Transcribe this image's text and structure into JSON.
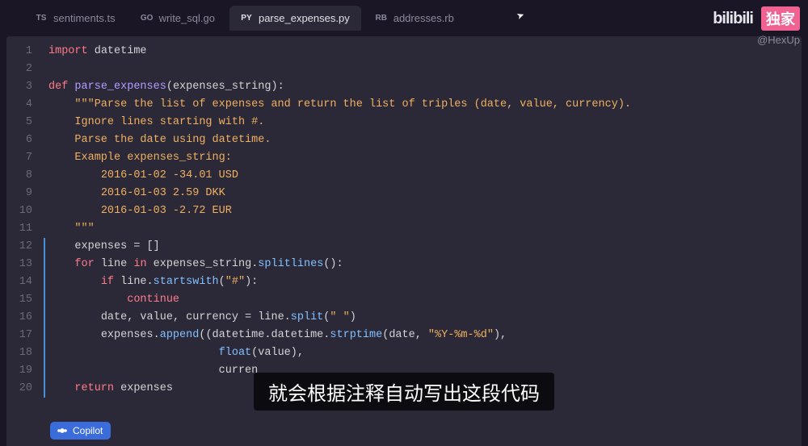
{
  "brand": {
    "logo_text": "bilibili",
    "exclusive_tag": "独家",
    "handle": "@HexUp"
  },
  "tabs": [
    {
      "icon": "TS",
      "label": "sentiments.ts",
      "active": false
    },
    {
      "icon": "GO",
      "label": "write_sql.go",
      "active": false
    },
    {
      "icon": "PY",
      "label": "parse_expenses.py",
      "active": true
    },
    {
      "icon": "RB",
      "label": "addresses.rb",
      "active": false
    }
  ],
  "code": {
    "lines": [
      {
        "n": 1,
        "hl": false,
        "tokens": [
          [
            "kw1",
            "import"
          ],
          [
            "pun",
            " "
          ],
          [
            "var",
            "datetime"
          ]
        ]
      },
      {
        "n": 2,
        "hl": false,
        "tokens": []
      },
      {
        "n": 3,
        "hl": false,
        "tokens": [
          [
            "kw2",
            "def"
          ],
          [
            "pun",
            " "
          ],
          [
            "fn",
            "parse_expenses"
          ],
          [
            "pun",
            "("
          ],
          [
            "var",
            "expenses_string"
          ],
          [
            "pun",
            "):"
          ]
        ]
      },
      {
        "n": 4,
        "hl": false,
        "tokens": [
          [
            "pun",
            "    "
          ],
          [
            "doc",
            "\"\"\"Parse the list of expenses and return the list of triples (date, value, currency)."
          ]
        ]
      },
      {
        "n": 5,
        "hl": false,
        "tokens": [
          [
            "pun",
            "    "
          ],
          [
            "doc",
            "Ignore lines starting with #."
          ]
        ]
      },
      {
        "n": 6,
        "hl": false,
        "tokens": [
          [
            "pun",
            "    "
          ],
          [
            "doc",
            "Parse the date using datetime."
          ]
        ]
      },
      {
        "n": 7,
        "hl": false,
        "tokens": [
          [
            "pun",
            "    "
          ],
          [
            "doc",
            "Example expenses_string:"
          ]
        ]
      },
      {
        "n": 8,
        "hl": false,
        "tokens": [
          [
            "pun",
            "        "
          ],
          [
            "doc",
            "2016-01-02 -34.01 USD"
          ]
        ]
      },
      {
        "n": 9,
        "hl": false,
        "tokens": [
          [
            "pun",
            "        "
          ],
          [
            "doc",
            "2016-01-03 2.59 DKK"
          ]
        ]
      },
      {
        "n": 10,
        "hl": false,
        "tokens": [
          [
            "pun",
            "        "
          ],
          [
            "doc",
            "2016-01-03 -2.72 EUR"
          ]
        ]
      },
      {
        "n": 11,
        "hl": false,
        "tokens": [
          [
            "pun",
            "    "
          ],
          [
            "doc",
            "\"\"\""
          ]
        ]
      },
      {
        "n": 12,
        "hl": true,
        "tokens": [
          [
            "pun",
            "    "
          ],
          [
            "var",
            "expenses"
          ],
          [
            "pun",
            " = []"
          ]
        ]
      },
      {
        "n": 13,
        "hl": true,
        "tokens": [
          [
            "pun",
            "    "
          ],
          [
            "kw3",
            "for"
          ],
          [
            "pun",
            " "
          ],
          [
            "var",
            "line"
          ],
          [
            "pun",
            " "
          ],
          [
            "kw3",
            "in"
          ],
          [
            "pun",
            " "
          ],
          [
            "var",
            "expenses_string"
          ],
          [
            "pun",
            "."
          ],
          [
            "mtd",
            "splitlines"
          ],
          [
            "pun",
            "():"
          ]
        ]
      },
      {
        "n": 14,
        "hl": true,
        "tokens": [
          [
            "pun",
            "        "
          ],
          [
            "kw3",
            "if"
          ],
          [
            "pun",
            " "
          ],
          [
            "var",
            "line"
          ],
          [
            "pun",
            "."
          ],
          [
            "mtd",
            "startswith"
          ],
          [
            "pun",
            "("
          ],
          [
            "str",
            "\"#\""
          ],
          [
            "pun",
            "):"
          ]
        ]
      },
      {
        "n": 15,
        "hl": true,
        "tokens": [
          [
            "pun",
            "            "
          ],
          [
            "kw3",
            "continue"
          ]
        ]
      },
      {
        "n": 16,
        "hl": true,
        "tokens": [
          [
            "pun",
            "        "
          ],
          [
            "var",
            "date"
          ],
          [
            "pun",
            ", "
          ],
          [
            "var",
            "value"
          ],
          [
            "pun",
            ", "
          ],
          [
            "var",
            "currency"
          ],
          [
            "pun",
            " = "
          ],
          [
            "var",
            "line"
          ],
          [
            "pun",
            "."
          ],
          [
            "mtd",
            "split"
          ],
          [
            "pun",
            "("
          ],
          [
            "str",
            "\" \""
          ],
          [
            "pun",
            ")"
          ]
        ]
      },
      {
        "n": 17,
        "hl": true,
        "tokens": [
          [
            "pun",
            "        "
          ],
          [
            "var",
            "expenses"
          ],
          [
            "pun",
            "."
          ],
          [
            "mtd",
            "append"
          ],
          [
            "pun",
            "(("
          ],
          [
            "var",
            "datetime"
          ],
          [
            "pun",
            "."
          ],
          [
            "var",
            "datetime"
          ],
          [
            "pun",
            "."
          ],
          [
            "mtd",
            "strptime"
          ],
          [
            "pun",
            "("
          ],
          [
            "var",
            "date"
          ],
          [
            "pun",
            ", "
          ],
          [
            "str",
            "\"%Y-%m-%d\""
          ],
          [
            "pun",
            "),"
          ]
        ]
      },
      {
        "n": 18,
        "hl": true,
        "tokens": [
          [
            "pun",
            "                          "
          ],
          [
            "mtd",
            "float"
          ],
          [
            "pun",
            "("
          ],
          [
            "var",
            "value"
          ],
          [
            "pun",
            "),"
          ]
        ]
      },
      {
        "n": 19,
        "hl": true,
        "tokens": [
          [
            "pun",
            "                          "
          ],
          [
            "var",
            "curren"
          ]
        ]
      },
      {
        "n": 20,
        "hl": true,
        "tokens": [
          [
            "pun",
            "    "
          ],
          [
            "kw1",
            "return"
          ],
          [
            "pun",
            " "
          ],
          [
            "var",
            "expenses"
          ]
        ]
      }
    ]
  },
  "subtitle": "就会根据注释自动写出这段代码",
  "copilot": {
    "label": "Copilot"
  }
}
